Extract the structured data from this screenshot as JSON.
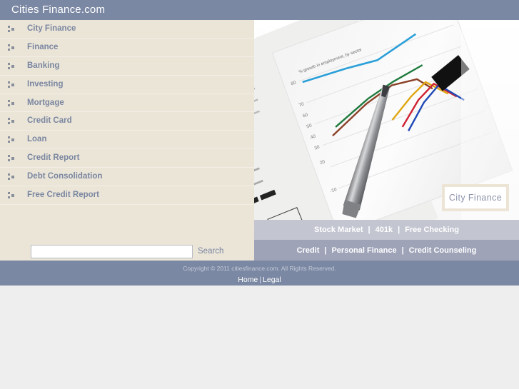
{
  "header": {
    "title": "Cities Finance.com"
  },
  "sidebar": {
    "items": [
      {
        "label": "City Finance"
      },
      {
        "label": "Finance"
      },
      {
        "label": "Banking"
      },
      {
        "label": "Investing"
      },
      {
        "label": "Mortgage"
      },
      {
        "label": "Credit Card"
      },
      {
        "label": "Loan"
      },
      {
        "label": "Credit Report"
      },
      {
        "label": "Debt Consolidation"
      },
      {
        "label": "Free Credit Report"
      }
    ],
    "search": {
      "value": "",
      "placeholder": "",
      "button_label": "Search"
    }
  },
  "content": {
    "hero": {
      "badge_label": "City Finance",
      "alt": "photo of a financial newspaper page showing line and bar charts with a silver pen resting on it"
    },
    "links_top": [
      {
        "label": "Stock Market"
      },
      {
        "label": "401k"
      },
      {
        "label": "Free Checking"
      }
    ],
    "links_bottom": [
      {
        "label": "Credit"
      },
      {
        "label": "Personal Finance"
      },
      {
        "label": "Credit Counseling"
      }
    ],
    "separator": "|"
  },
  "footer": {
    "copyright": "Copyright © 2011 citiesfinance.com. All Rights Reserved.",
    "links": [
      {
        "label": "Home"
      },
      {
        "label": "Legal"
      }
    ],
    "separator": "|"
  },
  "colors": {
    "header_bg": "#7b88a3",
    "sidebar_bg": "#ebe5d8",
    "link_text": "#7a86a0",
    "linkbar_top_bg": "#c3c6d1",
    "linkbar_bottom_bg": "#9ea3b8",
    "footer_bg": "#7b88a3",
    "page_bg": "#eeeeee",
    "badge_border": "#ece5d6"
  }
}
